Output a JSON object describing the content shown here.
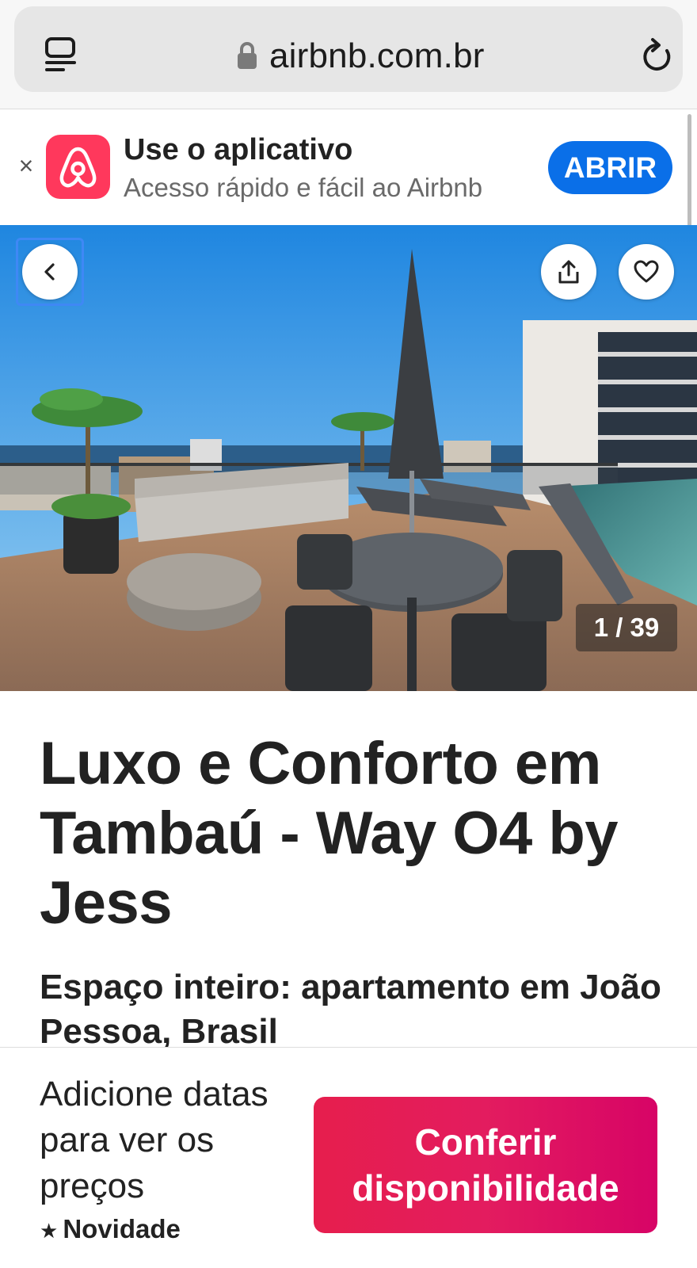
{
  "browser": {
    "url": "airbnb.com.br",
    "icons": [
      "tabs-icon",
      "lock-icon",
      "reload-icon"
    ]
  },
  "app_banner": {
    "close": "×",
    "title": "Use o aplicativo",
    "subtitle": "Acesso rápido e fácil ao Airbnb",
    "open_label": "ABRIR",
    "accent": "#0a6fe8",
    "logo_color": "#ff385c"
  },
  "photo": {
    "counter": "1 / 39",
    "icons": [
      "back-arrow-icon",
      "share-icon",
      "heart-icon"
    ]
  },
  "listing": {
    "title": "Luxo e Conforto em Tambaú - Way O4 by Jess",
    "subtitle": "Espaço inteiro: apartamento em João Pessoa, Brasil"
  },
  "footer": {
    "price_note": "Adicione datas para ver os preços",
    "rating_star": "★",
    "rating_label": "Novidade",
    "cta_label": "Conferir disponibilidade",
    "cta_color": "#e31c5f"
  }
}
